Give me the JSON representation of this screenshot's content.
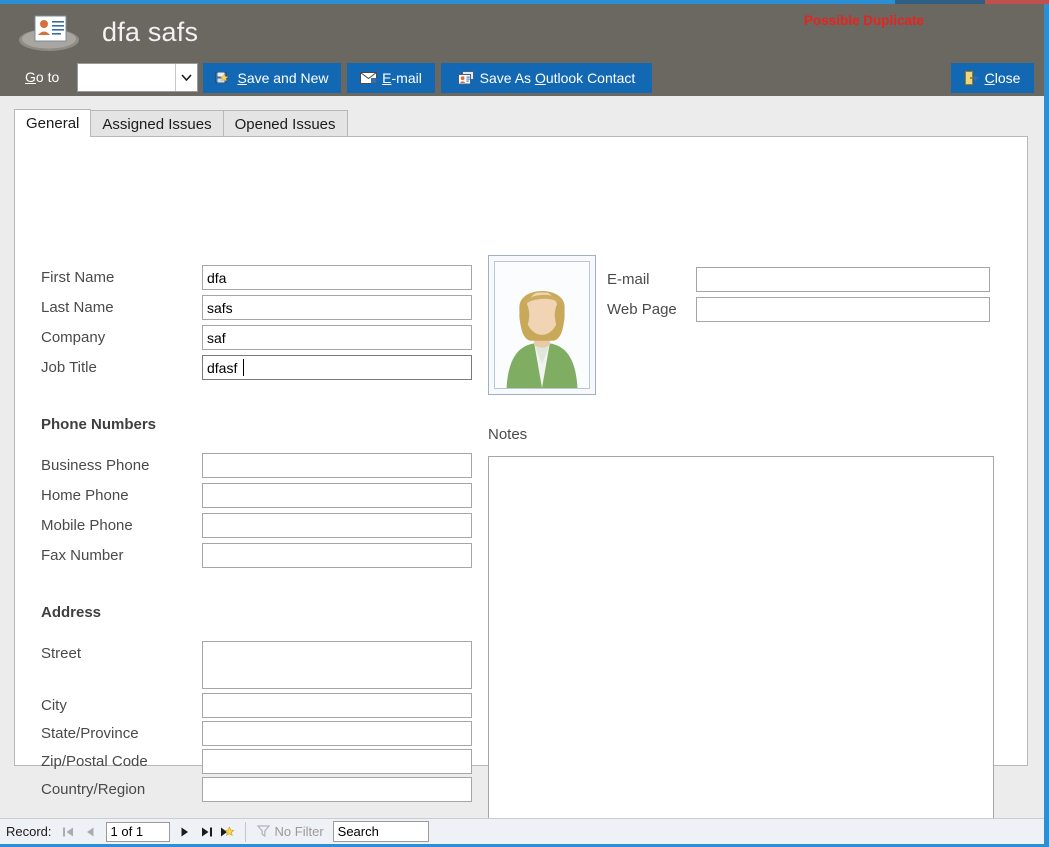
{
  "window": {
    "title": "dfa safs",
    "app_icon": "contact-card-icon",
    "duplicate_warning": "Possible Duplicate",
    "accent_blue": "#2b8fd6",
    "header_bg": "#6b6761",
    "button_blue": "#1268b3",
    "warning_red": "#e8231f"
  },
  "toolbar": {
    "goto_label_prefix": "G",
    "goto_label_rest": "o to",
    "goto_value": "",
    "buttons": [
      {
        "id": "save-and-new",
        "accel": "S",
        "before": "",
        "after": "ave and New",
        "icon": "save-new-icon"
      },
      {
        "id": "email",
        "accel": "E",
        "before": "",
        "after": "-mail",
        "icon": "email-icon"
      },
      {
        "id": "save-as-outlook-contact",
        "accel": "O",
        "before": "Save As ",
        "after": "utlook Contact",
        "icon": "outlook-contact-icon"
      },
      {
        "id": "close",
        "accel": "C",
        "before": "",
        "after": "lose",
        "icon": "close-door-icon"
      }
    ]
  },
  "tabs": [
    {
      "id": "general",
      "label": "General",
      "active": true
    },
    {
      "id": "assigned-issues",
      "label": "Assigned Issues",
      "active": false
    },
    {
      "id": "opened-issues",
      "label": "Opened Issues",
      "active": false
    }
  ],
  "form": {
    "identity": [
      {
        "id": "first-name",
        "label": "First Name",
        "value": "dfa",
        "focused": false
      },
      {
        "id": "last-name",
        "label": "Last Name",
        "value": "safs",
        "focused": false
      },
      {
        "id": "company",
        "label": "Company",
        "value": "saf",
        "focused": false
      },
      {
        "id": "job-title",
        "label": "Job Title",
        "value": "dfasf",
        "focused": true
      }
    ],
    "contact": [
      {
        "id": "e-mail",
        "label": "E-mail",
        "value": ""
      },
      {
        "id": "web-page",
        "label": "Web Page",
        "value": ""
      }
    ],
    "phone_section_title": "Phone Numbers",
    "phones": [
      {
        "id": "business-phone",
        "label": "Business Phone",
        "value": ""
      },
      {
        "id": "home-phone",
        "label": "Home Phone",
        "value": ""
      },
      {
        "id": "mobile-phone",
        "label": "Mobile Phone",
        "value": ""
      },
      {
        "id": "fax-number",
        "label": "Fax Number",
        "value": ""
      }
    ],
    "address_section_title": "Address",
    "address": [
      {
        "id": "street",
        "label": "Street",
        "value": "",
        "multiline": true
      },
      {
        "id": "city",
        "label": "City",
        "value": ""
      },
      {
        "id": "state-province",
        "label": "State/Province",
        "value": ""
      },
      {
        "id": "zip-postal-code",
        "label": "Zip/Postal Code",
        "value": ""
      },
      {
        "id": "country-region",
        "label": "Country/Region",
        "value": ""
      }
    ],
    "notes_label": "Notes",
    "notes_value": "",
    "photo_alt": "contact-photo-placeholder"
  },
  "statusbar": {
    "record_label": "Record:",
    "record_position": "1 of 1",
    "first_enabled": false,
    "previous_enabled": false,
    "next_enabled": true,
    "last_enabled": true,
    "new_record_enabled": true,
    "filter_text": "No Filter",
    "filter_enabled": false,
    "search_value": "Search"
  }
}
